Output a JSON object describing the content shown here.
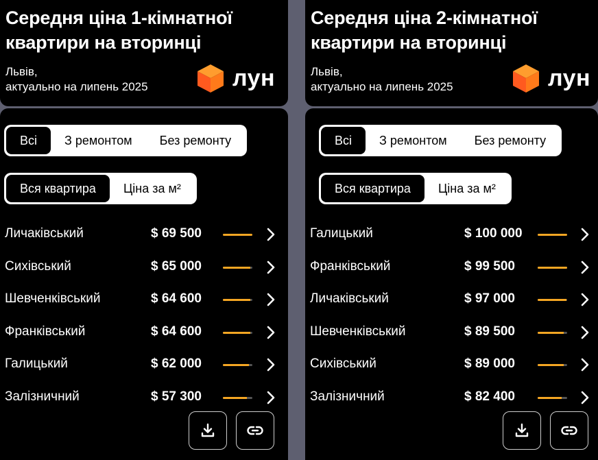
{
  "colors": {
    "accent": "#f5a623",
    "panel_bg": "#000000",
    "gap_bg": "#5e5f70",
    "track": "#555555"
  },
  "panels": [
    {
      "title": "Середня ціна 1-кімнатної квартири на вторинці",
      "city": "Львів,",
      "date": "актуально на липень 2025",
      "logo": "лун",
      "tabs1": [
        "Всі",
        "З ремонтом",
        "Без ремонту"
      ],
      "tabs2": [
        "Вся квартира",
        "Ціна за м²"
      ],
      "rows": [
        {
          "district": "Личаківський",
          "price": "$ 69 500",
          "bar": 1.0
        },
        {
          "district": "Сихівський",
          "price": "$ 65 000",
          "bar": 0.94
        },
        {
          "district": "Шевченківський",
          "price": "$ 64 600",
          "bar": 0.93
        },
        {
          "district": "Франківський",
          "price": "$ 64 600",
          "bar": 0.93
        },
        {
          "district": "Галицький",
          "price": "$ 62 000",
          "bar": 0.89
        },
        {
          "district": "Залізничний",
          "price": "$ 57 300",
          "bar": 0.82
        }
      ]
    },
    {
      "title": "Середня ціна 2-кімнатної квартири на вторинці",
      "city": "Львів,",
      "date": "актуально на липень 2025",
      "logo": "лун",
      "tabs1": [
        "Всі",
        "З ремонтом",
        "Без ремонту"
      ],
      "tabs2": [
        "Вся квартира",
        "Ціна за м²"
      ],
      "rows": [
        {
          "district": "Галицький",
          "price": "$ 100 000",
          "bar": 1.0
        },
        {
          "district": "Франківський",
          "price": "$ 99 500",
          "bar": 0.995
        },
        {
          "district": "Личаківський",
          "price": "$ 97 000",
          "bar": 0.97
        },
        {
          "district": "Шевченківський",
          "price": "$ 89 500",
          "bar": 0.895
        },
        {
          "district": "Сихівський",
          "price": "$ 89 000",
          "bar": 0.89
        },
        {
          "district": "Залізничний",
          "price": "$ 82 400",
          "bar": 0.824
        }
      ]
    }
  ],
  "icons": {
    "download": "download-icon",
    "link": "link-icon",
    "chevron": "chevron-right-icon",
    "logo": "cube-logo-icon"
  }
}
